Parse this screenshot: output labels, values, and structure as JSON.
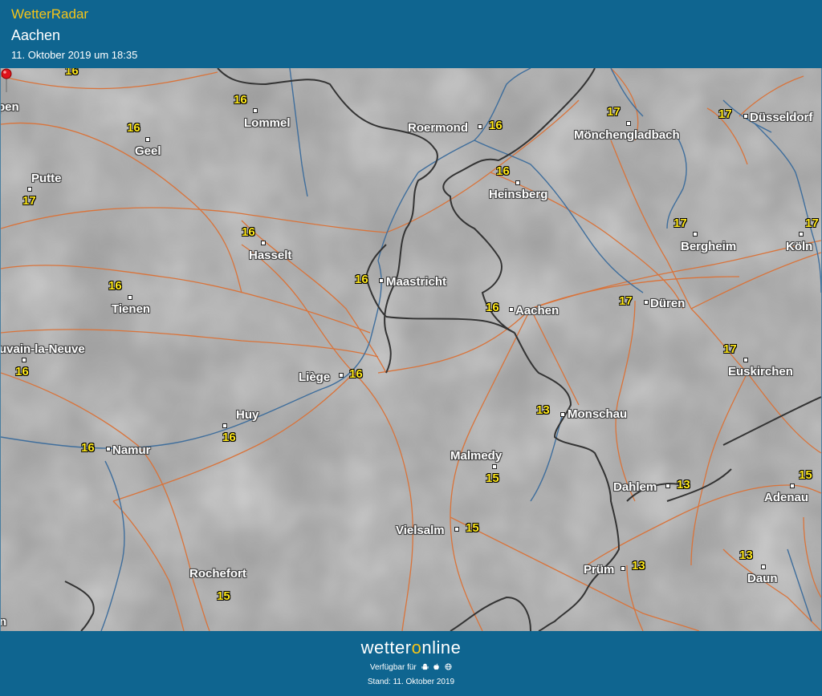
{
  "header": {
    "app_title": "WetterRadar",
    "city": "Aachen",
    "timestamp": "11. Oktober 2019 um 18:35"
  },
  "map": {
    "colors": {
      "border": "#333333",
      "road": "#d9733a",
      "river": "#3f6e9c",
      "temperature": "#ffe81a",
      "label": "#ffffff"
    },
    "selected_location": "Aachen",
    "places": [
      {
        "name": "Lommel",
        "temp": "16"
      },
      {
        "name": "Geel",
        "temp": "16"
      },
      {
        "name": "Putte",
        "temp": "17"
      },
      {
        "name": "Hasselt",
        "temp": "16"
      },
      {
        "name": "Tienen",
        "temp": "16"
      },
      {
        "name": "Maastricht",
        "temp": "16"
      },
      {
        "name": "uvain-la-Neuve",
        "temp": "16"
      },
      {
        "name": "Liège",
        "temp": "16"
      },
      {
        "name": "Huy",
        "temp": "16"
      },
      {
        "name": "Namur",
        "temp": "16"
      },
      {
        "name": "Rochefort",
        "temp": "15"
      },
      {
        "name": "Vielsalm",
        "temp": "15"
      },
      {
        "name": "Malmedy",
        "temp": "15"
      },
      {
        "name": "Roermond",
        "temp": "16"
      },
      {
        "name": "Heinsberg",
        "temp": "16"
      },
      {
        "name": "Aachen",
        "temp": "16"
      },
      {
        "name": "Monschau",
        "temp": "13"
      },
      {
        "name": "Mönchengladbach",
        "temp": "17"
      },
      {
        "name": "Düsseldorf",
        "temp": "17"
      },
      {
        "name": "Bergheim",
        "temp": "17"
      },
      {
        "name": "Köln",
        "temp": "17"
      },
      {
        "name": "Düren",
        "temp": "17"
      },
      {
        "name": "Euskirchen",
        "temp": "17"
      },
      {
        "name": "Dahlem",
        "temp": "13"
      },
      {
        "name": "Adenau",
        "temp": "15"
      },
      {
        "name": "Prüm",
        "temp": "13"
      },
      {
        "name": "Daun",
        "temp": "13"
      }
    ],
    "edge_temps": [
      "16"
    ],
    "edge_labels": [
      "pen",
      "n"
    ]
  },
  "footer": {
    "brand_part1": "wetter",
    "brand_o": "o",
    "brand_part2": "nline",
    "available": "Verfügbar für",
    "stand": "Stand: 11. Oktober 2019"
  }
}
